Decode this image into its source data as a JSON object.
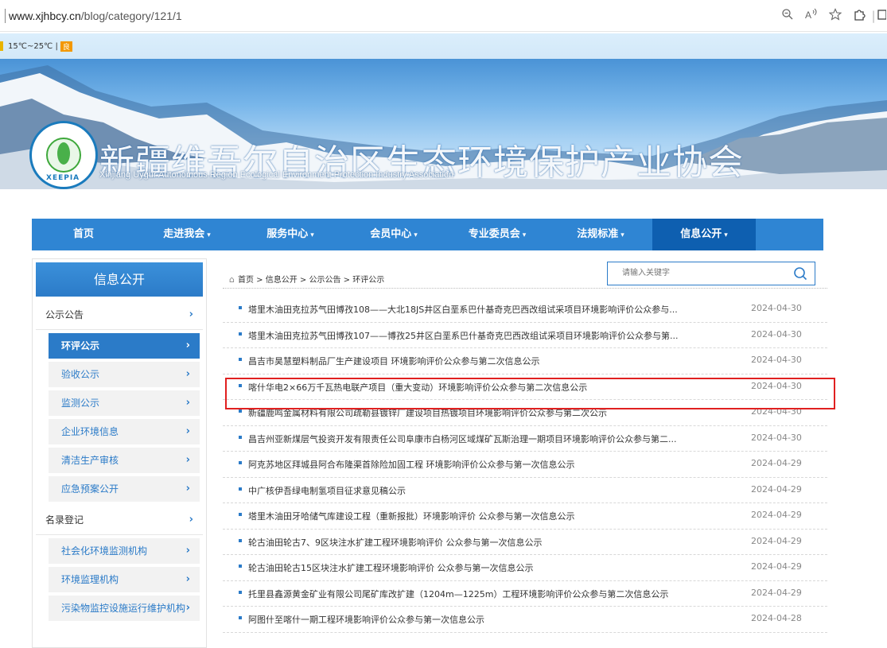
{
  "browser": {
    "url_host": "www.xjhbcy.cn",
    "url_path": "/blog/category/121/1"
  },
  "weather": {
    "temp": "15℃~25℃ |",
    "quality": "良"
  },
  "banner": {
    "title": "新疆维吾尔自治区生态环境保护产业协会",
    "subtitle": "Xinjiang Uygur Autonomous Region Ecological Environment Protection Industry Association",
    "logo_text": "XEEPIA"
  },
  "nav": {
    "items": [
      {
        "label": "首页",
        "caret": ""
      },
      {
        "label": "走进我会",
        "caret": "▾"
      },
      {
        "label": "服务中心",
        "caret": "▾"
      },
      {
        "label": "会员中心",
        "caret": "▾"
      },
      {
        "label": "专业委员会",
        "caret": "▾"
      },
      {
        "label": "法规标准",
        "caret": "▾"
      },
      {
        "label": "信息公开",
        "caret": "▾"
      }
    ]
  },
  "sidebar": {
    "heading": "信息公开",
    "cat1": "公示公告",
    "subs1": [
      "环评公示",
      "验收公示",
      "监测公示",
      "企业环境信息",
      "清洁生产审核",
      "应急预案公开"
    ],
    "cat2": "名录登记",
    "subs2": [
      "社会化环境监测机构",
      "环境监理机构",
      "污染物监控设施运行维护机构"
    ],
    "arrow": "›"
  },
  "content": {
    "breadcrumb": "首页 > 信息公开 > 公示公告 > 环评公示",
    "search_placeholder": "请输入关键字",
    "rows": [
      {
        "title": "塔里木油田克拉苏气田博孜108——大北18JS井区白垩系巴什基奇克巴西改组试采项目环境影响评价公众参与...",
        "date": "2024-04-30"
      },
      {
        "title": "塔里木油田克拉苏气田博孜107——博孜25井区白垩系巴什基奇克巴西改组试采项目环境影响评价公众参与第...",
        "date": "2024-04-30"
      },
      {
        "title": "昌吉市昊慧塑料制品厂生产建设项目 环境影响评价公众参与第二次信息公示",
        "date": "2024-04-30"
      },
      {
        "title": "喀什华电2×66万千瓦热电联产项目（重大变动）环境影响评价公众参与第二次信息公示",
        "date": "2024-04-30"
      },
      {
        "title": "新疆鹿鸣金属材料有限公司疏勒县镀锌厂建设项目热镀项目环境影响评价公众参与第二次公示",
        "date": "2024-04-30"
      },
      {
        "title": "昌吉州亚新煤层气投资开发有限责任公司阜康市白杨河区域煤矿瓦斯治理一期项目环境影响评价公众参与第二...",
        "date": "2024-04-30"
      },
      {
        "title": "阿克苏地区拜城县阿合布隆渠首除险加固工程 环境影响评价公众参与第一次信息公示",
        "date": "2024-04-29"
      },
      {
        "title": "中广核伊吾绿电制氢项目征求意见稿公示",
        "date": "2024-04-29"
      },
      {
        "title": "塔里木油田牙哈储气库建设工程（重新报批）环境影响评价 公众参与第一次信息公示",
        "date": "2024-04-29"
      },
      {
        "title": "轮古油田轮古7、9区块注水扩建工程环境影响评价 公众参与第一次信息公示",
        "date": "2024-04-29"
      },
      {
        "title": "轮古油田轮古15区块注水扩建工程环境影响评价 公众参与第一次信息公示",
        "date": "2024-04-29"
      },
      {
        "title": "托里县鑫源黄金矿业有限公司尾矿库改扩建（1204m—1225m）工程环境影响评价公众参与第二次信息公示",
        "date": "2024-04-29"
      },
      {
        "title": "阿图什至喀什一期工程环境影响评价公众参与第一次信息公示",
        "date": "2024-04-28"
      }
    ]
  },
  "colors": {
    "nav_blue": "#2f85d3",
    "active_blue": "#0e5fb0",
    "highlight_red": "#e02020"
  }
}
